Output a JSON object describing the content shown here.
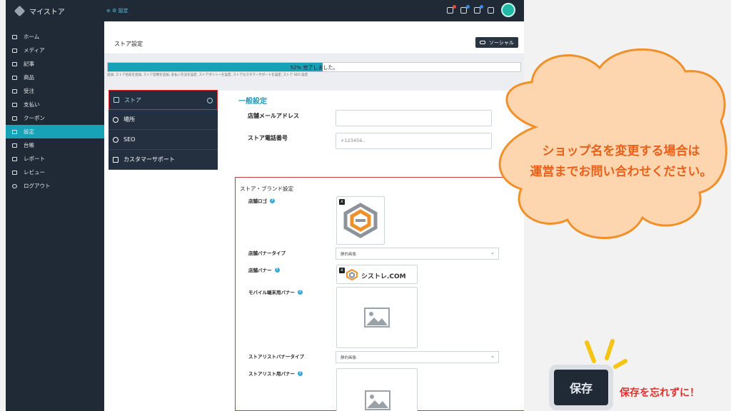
{
  "app": {
    "title": "マイストア"
  },
  "breadcrumb": {
    "text": "≡ ⚙ 設定"
  },
  "header_icon_badges": [
    "#e74c3c",
    "#3a8dde",
    "#3a8dde"
  ],
  "sidebar": {
    "items": [
      {
        "label": "ホーム",
        "icon": "monitor-icon"
      },
      {
        "label": "メディア",
        "icon": "image-icon"
      },
      {
        "label": "記事",
        "icon": "article-icon"
      },
      {
        "label": "商品",
        "icon": "product-icon"
      },
      {
        "label": "受注",
        "icon": "cart-icon"
      },
      {
        "label": "支払い",
        "icon": "card-icon"
      },
      {
        "label": "クーポン",
        "icon": "coupon-icon"
      },
      {
        "label": "設定",
        "icon": "settings-icon",
        "active": true
      },
      {
        "label": "台帳",
        "icon": "ledger-icon"
      },
      {
        "label": "レポート",
        "icon": "chart-icon"
      },
      {
        "label": "レビュー",
        "icon": "review-icon"
      },
      {
        "label": "ログアウト",
        "icon": "power-icon"
      }
    ]
  },
  "page": {
    "title": "ストア設定",
    "social_button": "ソーシャル",
    "progress_label": "52% 完了しました。",
    "progress_value": 0.52,
    "hint": "追加: ストア名前を追加, ストア説明を追加, 支払い方法を設定, ストアポリシーを設定, ストアカスタマーサポートを設定, ストア SEO 設定"
  },
  "tabs": [
    {
      "label": "ストア",
      "icon": "store-icon",
      "active": true
    },
    {
      "label": "場所",
      "icon": "globe-icon"
    },
    {
      "label": "SEO",
      "icon": "globe-icon"
    },
    {
      "label": "カスタマーサポート",
      "icon": "thumbs-up-icon"
    }
  ],
  "general": {
    "heading": "一般設定",
    "email_label": "店舗メールアドレス",
    "email_value": "",
    "phone_label": "ストア電話番号",
    "phone_placeholder": "+123456.."
  },
  "brand_settings": {
    "title": "ストア・ブランド設定",
    "logo_label": "店舗ロゴ",
    "banner_type_label": "店舗バナータイプ",
    "banner_type_value": "静的画像",
    "banner_label": "店舗バナー",
    "banner_brand_text": "シストレ.COM",
    "mobile_banner_label": "モバイル端末用バナー",
    "list_banner_type_label": "ストアリストバナータイプ",
    "list_banner_type_value": "静的画像",
    "list_banner_label": "ストアリスト用バナー"
  },
  "callout": {
    "text": "ショップ名を変更する場合は\n運営までお問い合わせください。",
    "cloud_fill": "#fdd6b0",
    "cloud_stroke": "#f0902a"
  },
  "save": {
    "button": "保存",
    "note": "保存を忘れずに！",
    "burst_color": "#f6c413"
  }
}
